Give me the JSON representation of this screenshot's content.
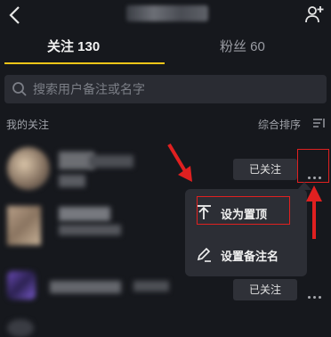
{
  "header": {
    "back_icon": "chevron-left-icon",
    "add_friend_icon": "add-user-icon"
  },
  "tabs": [
    {
      "label": "关注 130",
      "active": true
    },
    {
      "label": "粉丝 60",
      "active": false
    }
  ],
  "accent_color": "#f5c518",
  "search": {
    "placeholder": "搜索用户备注或名字",
    "icon": "search-icon"
  },
  "section": {
    "title": "我的关注",
    "sort_label": "综合排序",
    "sort_icon": "sort-icon"
  },
  "rows": [
    {
      "button_label": "已关注",
      "more_icon": "more-icon"
    },
    {
      "button_label": "已关注",
      "more_icon": "more-icon"
    }
  ],
  "popup_menu": {
    "items": [
      {
        "label": "设为置顶",
        "icon": "pin-top-icon"
      },
      {
        "label": "设置备注名",
        "icon": "edit-icon"
      }
    ]
  },
  "annotation_color": "#e02020"
}
